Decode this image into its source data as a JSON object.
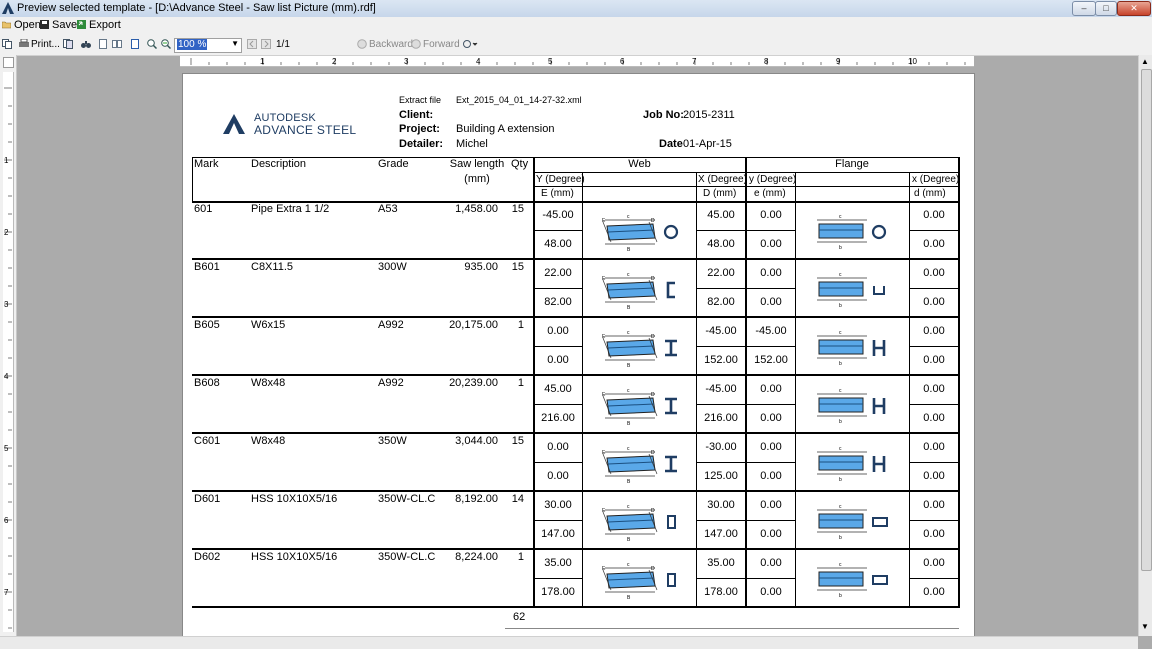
{
  "window": {
    "title": "Preview selected template - [D:\\Advance Steel - Saw list Picture (mm).rdf]"
  },
  "menu": [
    {
      "label": "Open",
      "icon": "folder-open-icon"
    },
    {
      "label": "Save",
      "icon": "save-icon"
    },
    {
      "label": "Export",
      "icon": "export-icon"
    }
  ],
  "toolbar": {
    "print_label": "Print...",
    "zoom": "100 %",
    "page": "1/1",
    "backward_label": "Backward",
    "forward_label": "Forward"
  },
  "ruler": {
    "numbers": [
      "1",
      "2",
      "3",
      "4",
      "5",
      "6",
      "7",
      "8",
      "9",
      "10"
    ],
    "vnumbers": [
      "1",
      "2",
      "3",
      "4",
      "5",
      "6",
      "7"
    ]
  },
  "report": {
    "logo_line1": "AUTODESK",
    "logo_line2": "ADVANCE STEEL",
    "extract_label": "Extract file",
    "extract_value": "Ext_2015_04_01_14-27-32.xml",
    "client_label": "Client:",
    "client_value": "",
    "project_label": "Project:",
    "project_value": "Building A extension",
    "detailer_label": "Detailer:",
    "detailer_value": "Michel",
    "jobno_label": "Job No:",
    "jobno_value": "2015-2311",
    "date_label": "Date",
    "date_value": "01-Apr-15",
    "total_qty": "62"
  },
  "table": {
    "headers": {
      "mark": "Mark",
      "description": "Description",
      "grade": "Grade",
      "saw_length": "Saw length",
      "saw_length_unit": "(mm)",
      "qty": "Qty",
      "web": "Web",
      "flange": "Flange",
      "web_y": "Y (Degree)",
      "web_e": "E (mm)",
      "web_x": "X (Degree)",
      "web_d": "D (mm)",
      "fl_y": "y (Degree)",
      "fl_e": "e (mm)",
      "fl_x": "x (Degree)",
      "fl_d": "d (mm)"
    },
    "rows": [
      {
        "mark": "601",
        "desc": "Pipe Extra  1 1/2",
        "grade": "A53",
        "len": "1,458.00",
        "qty": "15",
        "wy": "-45.00",
        "we": "48.00",
        "wx": "45.00",
        "wd": "48.00",
        "fy": "0.00",
        "fe": "0.00",
        "fx": "0.00",
        "fd": "0.00",
        "web_shape": "O",
        "fl_shape": "O"
      },
      {
        "mark": "B601",
        "desc": "C8X11.5",
        "grade": "300W",
        "len": "935.00",
        "qty": "15",
        "wy": "22.00",
        "we": "82.00",
        "wx": "22.00",
        "wd": "82.00",
        "fy": "0.00",
        "fe": "0.00",
        "fx": "0.00",
        "fd": "0.00",
        "web_shape": "C",
        "fl_shape": "U"
      },
      {
        "mark": "B605",
        "desc": "W6x15",
        "grade": "A992",
        "len": "20,175.00",
        "qty": "1",
        "wy": "0.00",
        "we": "0.00",
        "wx": "-45.00",
        "wd": "152.00",
        "fy": "-45.00",
        "fe": "152.00",
        "fx": "0.00",
        "fd": "0.00",
        "web_shape": "I",
        "fl_shape": "H"
      },
      {
        "mark": "B608",
        "desc": "W8x48",
        "grade": "A992",
        "len": "20,239.00",
        "qty": "1",
        "wy": "45.00",
        "we": "216.00",
        "wx": "-45.00",
        "wd": "216.00",
        "fy": "0.00",
        "fe": "0.00",
        "fx": "0.00",
        "fd": "0.00",
        "web_shape": "I",
        "fl_shape": "H"
      },
      {
        "mark": "C601",
        "desc": "W8x48",
        "grade": "350W",
        "len": "3,044.00",
        "qty": "15",
        "wy": "0.00",
        "we": "0.00",
        "wx": "-30.00",
        "wd": "125.00",
        "fy": "0.00",
        "fe": "0.00",
        "fx": "0.00",
        "fd": "0.00",
        "web_shape": "I",
        "fl_shape": "H"
      },
      {
        "mark": "D601",
        "desc": "HSS 10X10X5/16",
        "grade": "350W-CL.C",
        "len": "8,192.00",
        "qty": "14",
        "wy": "30.00",
        "we": "147.00",
        "wx": "30.00",
        "wd": "147.00",
        "fy": "0.00",
        "fe": "0.00",
        "fx": "0.00",
        "fd": "0.00",
        "web_shape": "RECTV",
        "fl_shape": "RECTH"
      },
      {
        "mark": "D602",
        "desc": "HSS 10X10X5/16",
        "grade": "350W-CL.C",
        "len": "8,224.00",
        "qty": "1",
        "wy": "35.00",
        "we": "178.00",
        "wx": "35.00",
        "wd": "178.00",
        "fy": "0.00",
        "fe": "0.00",
        "fx": "0.00",
        "fd": "0.00",
        "web_shape": "RECTV",
        "fl_shape": "RECTH"
      }
    ]
  },
  "colors": {
    "member_fill": "#5aa8e8",
    "logo": "#1f3d63"
  }
}
